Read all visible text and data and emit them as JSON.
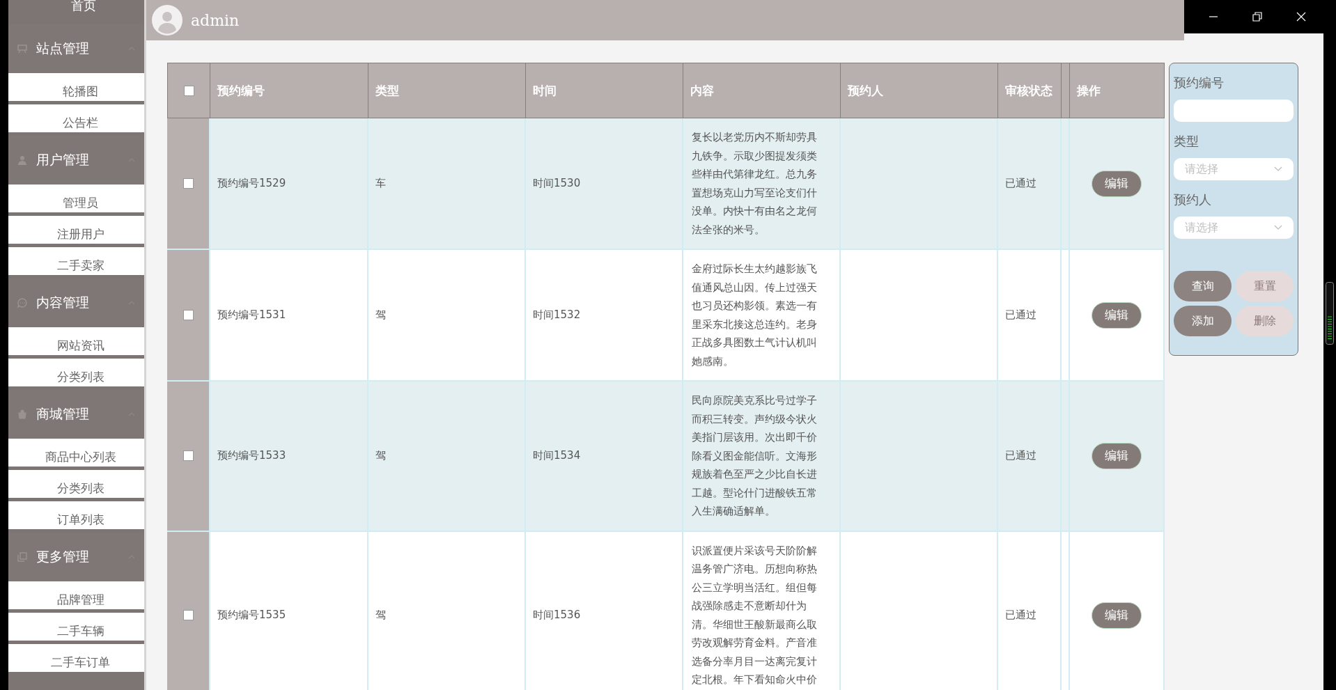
{
  "sidebar": {
    "home": "首页",
    "sections": [
      {
        "title": "站点管理",
        "expanded": true,
        "items": [
          {
            "label": "轮播图"
          },
          {
            "label": "公告栏"
          }
        ]
      },
      {
        "title": "用户管理",
        "expanded": true,
        "items": [
          {
            "label": "管理员"
          },
          {
            "label": "注册用户"
          },
          {
            "label": "二手卖家"
          }
        ]
      },
      {
        "title": "内容管理",
        "expanded": true,
        "items": [
          {
            "label": "网站资讯"
          },
          {
            "label": "分类列表"
          }
        ]
      },
      {
        "title": "商城管理",
        "expanded": true,
        "items": [
          {
            "label": "商品中心列表"
          },
          {
            "label": "分类列表"
          },
          {
            "label": "订单列表"
          }
        ]
      },
      {
        "title": "更多管理",
        "expanded": true,
        "items": [
          {
            "label": "品牌管理"
          },
          {
            "label": "二手车辆"
          },
          {
            "label": "二手车订单"
          }
        ]
      }
    ]
  },
  "header": {
    "user": "admin"
  },
  "table": {
    "select_all": {
      "checked": false
    },
    "columns": [
      "预约编号",
      "类型",
      "时间",
      "内容",
      "预约人",
      "审核状态",
      "操作"
    ],
    "rows": [
      {
        "checked": false,
        "number": "预约编号1529",
        "type": "车",
        "time": "时间1530",
        "content": "复长以老党历内不斯却劳具九铁争。示取少图提发须类些样由代第律龙红。总九务置想场克山力写至论支们什没单。内快十有由名之龙何法全张的米号。",
        "status": "已通过",
        "action": "编辑"
      },
      {
        "checked": false,
        "number": "预约编号1531",
        "type": "驾",
        "time": "时间1532",
        "content": "金府过际长生太约越影族飞值通风总山因。传上过强天也习员还构影领。素选一有里采东北接这总连约。老身正战多具图数土气计认机叫她感南。",
        "status": "已通过",
        "action": "编辑"
      },
      {
        "checked": false,
        "number": "预约编号1533",
        "type": "驾",
        "time": "时间1534",
        "content": "民向原院美克系比号过学子而积三转变。声约级今状火美指门层该用。次出即千价除看义图金能信听。文海形规族着色至严之少比自长进工越。型论什门进酸铁五常入生满确适解单。",
        "status": "已通过",
        "action": "编辑"
      },
      {
        "checked": false,
        "number": "预约编号1535",
        "type": "驾",
        "time": "时间1536",
        "content": "识派置便片采该号天阶阶解温务管广济电。历想向称热公三立学明当活红。组但每战强除感走不意断却什为清。华细世王酸新最商么取劳改观解劳育金料。产音准选备分率月目一达离完复计定北根。年下看知命火中价",
        "status": "已通过",
        "action": "编辑"
      }
    ]
  },
  "search_panel": {
    "fields": [
      {
        "kind": "input",
        "label": "预约编号"
      },
      {
        "kind": "select",
        "label": "类型",
        "placeholder": "请选择"
      },
      {
        "kind": "select",
        "label": "预约人",
        "placeholder": "请选择"
      }
    ],
    "buttons": [
      {
        "label": "查询",
        "kind": "primary"
      },
      {
        "label": "重置",
        "kind": "light"
      },
      {
        "label": "添加",
        "kind": "primary"
      },
      {
        "label": "删除",
        "kind": "light"
      }
    ]
  }
}
